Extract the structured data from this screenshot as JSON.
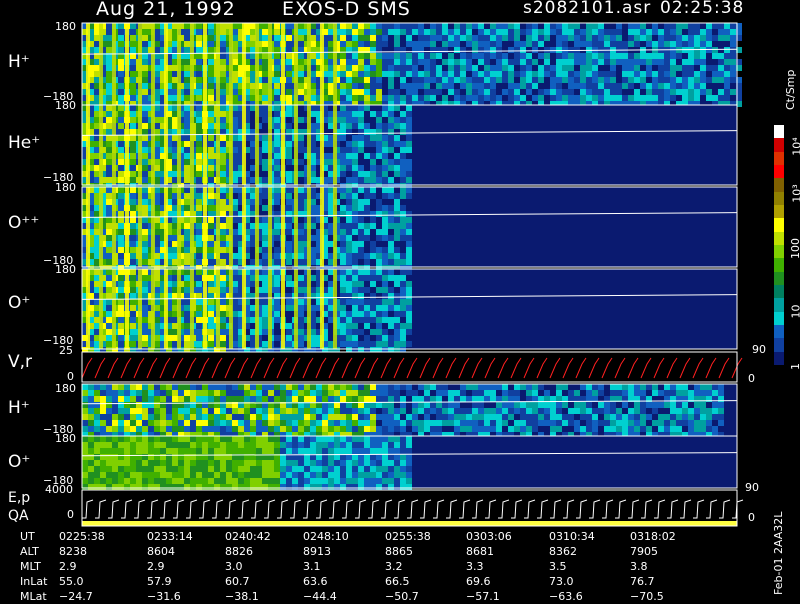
{
  "header": {
    "date": "Aug 21, 1992",
    "instrument": "EXOS-D SMS",
    "file": "s2082101.asr",
    "time": "02:25:38"
  },
  "colorbar": {
    "units": "Ct/Smp",
    "ticks": [
      "10⁴",
      "10³",
      "100",
      "10",
      "1"
    ],
    "colors": [
      "#ffffff",
      "#d00000",
      "#e03000",
      "#ff0000",
      "#806000",
      "#908000",
      "#b0a000",
      "#ffff00",
      "#c0e000",
      "#80d000",
      "#40b000",
      "#209020",
      "#008060",
      "#00a0a0",
      "#00d0d0",
      "#1060c0",
      "#1040a0",
      "#0a1a70"
    ]
  },
  "panels": [
    {
      "label": "H⁺",
      "top": "180",
      "bottom": "−180"
    },
    {
      "label": "He⁺",
      "top": "180",
      "bottom": "−180"
    },
    {
      "label": "O⁺⁺",
      "top": "180",
      "bottom": "−180"
    },
    {
      "label": "O⁺",
      "top": "180",
      "bottom": "−180"
    },
    {
      "label": "V,r",
      "top": "25",
      "bottom": "0",
      "right_top": "90",
      "right_bottom": "0"
    },
    {
      "label": "H⁺",
      "top": "180",
      "bottom": "−180"
    },
    {
      "label": "O⁺",
      "top": "180",
      "bottom": "−180",
      "right_bottom": "90"
    },
    {
      "label": "E,p",
      "label2": "QA",
      "top": "4000",
      "bottom": "0",
      "right_bottom": "0"
    }
  ],
  "chart_data": {
    "type": "heatmap",
    "title": "Aug 21, 1992   EXOS-D SMS",
    "x": [
      "0225:38",
      "0233:14",
      "0240:42",
      "0248:10",
      "0255:38",
      "0303:06",
      "0310:34",
      "0318:02"
    ],
    "table": {
      "rows": [
        {
          "name": "UT",
          "values": [
            "0225:38",
            "0233:14",
            "0240:42",
            "0248:10",
            "0255:38",
            "0303:06",
            "0310:34",
            "0318:02"
          ]
        },
        {
          "name": "ALT",
          "values": [
            "8238",
            "8604",
            "8826",
            "8913",
            "8865",
            "8681",
            "8362",
            "7905"
          ]
        },
        {
          "name": "MLT",
          "values": [
            "2.9",
            "2.9",
            "3.0",
            "3.1",
            "3.2",
            "3.3",
            "3.5",
            "3.8"
          ]
        },
        {
          "name": "InLat",
          "values": [
            "55.0",
            "57.9",
            "60.7",
            "63.6",
            "66.5",
            "69.6",
            "73.0",
            "76.7"
          ]
        },
        {
          "name": "MLat",
          "values": [
            "−24.7",
            "−31.6",
            "−38.1",
            "−44.4",
            "−50.7",
            "−57.1",
            "−63.6",
            "−70.5"
          ]
        }
      ]
    }
  },
  "footer": {
    "stamp": "Feb-01 2AA32L"
  }
}
